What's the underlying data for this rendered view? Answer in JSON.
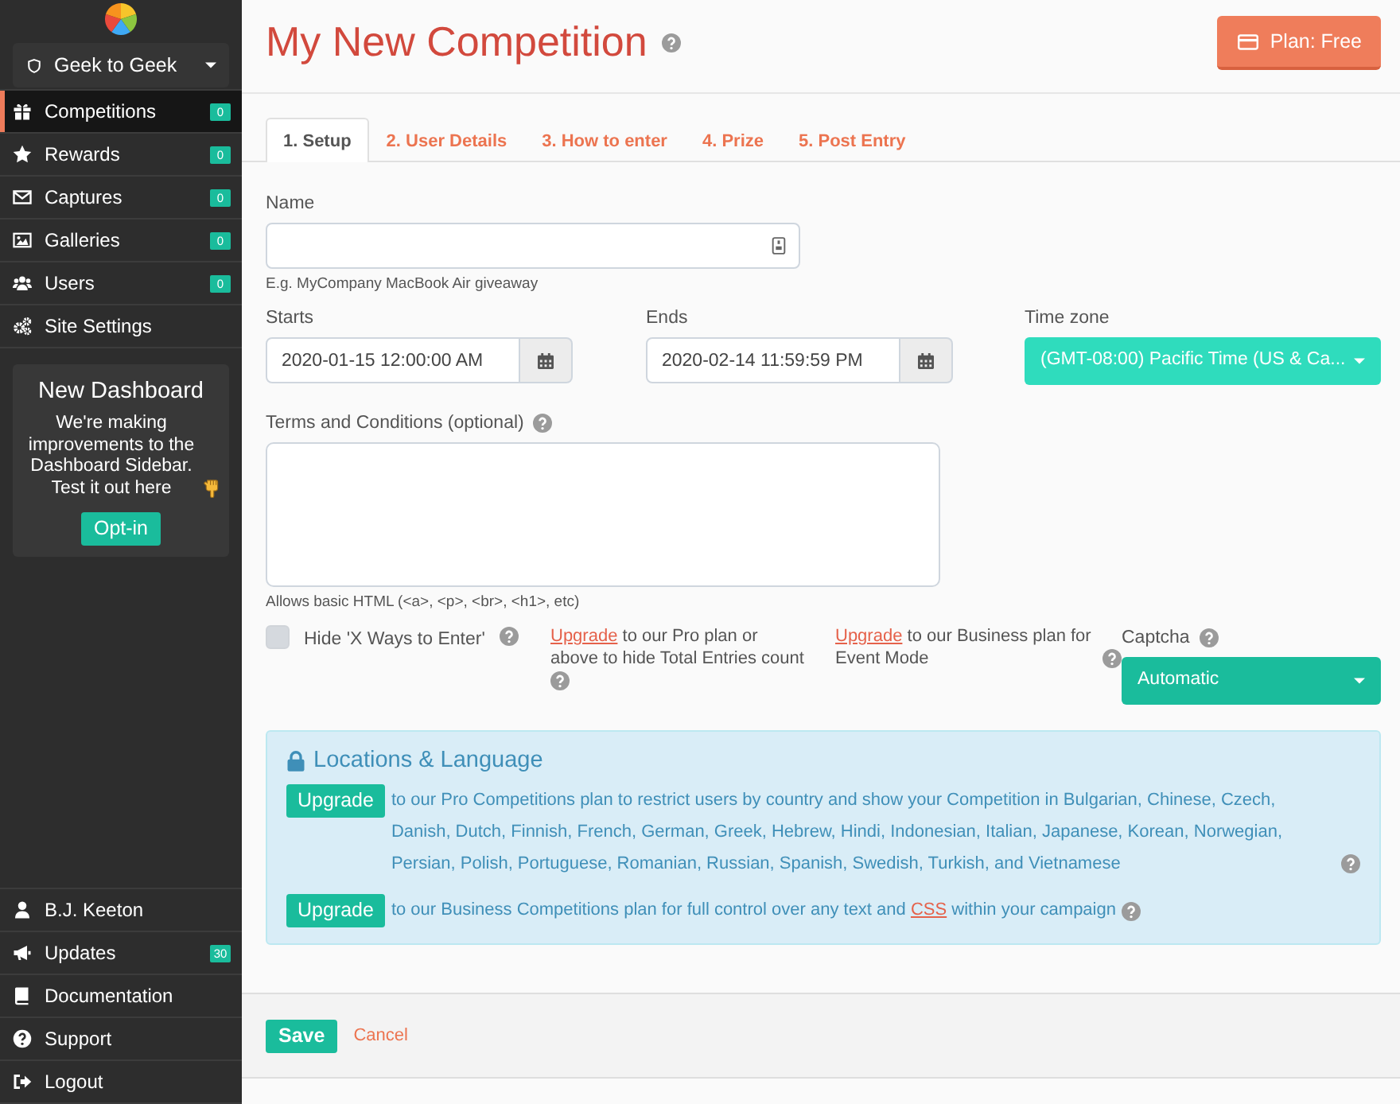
{
  "sidebar": {
    "account": "Geek to Geek",
    "nav_items": [
      {
        "label": "Competitions",
        "badge": "0",
        "selected": true
      },
      {
        "label": "Rewards",
        "badge": "0",
        "selected": false
      },
      {
        "label": "Captures",
        "badge": "0",
        "selected": false
      },
      {
        "label": "Galleries",
        "badge": "0",
        "selected": false
      },
      {
        "label": "Users",
        "badge": "0",
        "selected": false
      },
      {
        "label": "Site Settings",
        "selected": false
      }
    ],
    "promo": {
      "title": "New Dashboard",
      "text": "We're making improvements to the Dashboard Sidebar. Test it out here",
      "button": "Opt-in"
    },
    "footer_items": [
      {
        "label": "B.J. Keeton"
      },
      {
        "label": "Updates",
        "badge": "30"
      },
      {
        "label": "Documentation"
      },
      {
        "label": "Support"
      },
      {
        "label": "Logout"
      }
    ]
  },
  "header": {
    "title": "My New Competition",
    "plan_button": "Plan: Free"
  },
  "tabs": [
    {
      "label": "1. Setup",
      "selected": true
    },
    {
      "label": "2. User Details",
      "selected": false
    },
    {
      "label": "3. How to enter",
      "selected": false
    },
    {
      "label": "4. Prize",
      "selected": false
    },
    {
      "label": "5. Post Entry",
      "selected": false
    }
  ],
  "form": {
    "name": {
      "label": "Name",
      "help": "E.g. MyCompany MacBook Air giveaway"
    },
    "dates": [
      {
        "label": "Starts",
        "value": "2020-01-15 12:00:00 AM"
      },
      {
        "label": "Ends",
        "value": "2020-02-14 11:59:59 PM"
      }
    ],
    "time_zone": {
      "label": "Time zone",
      "value": "(GMT-08:00) Pacific Time (US & Ca..."
    },
    "terms": {
      "label": "Terms and Conditions (optional)",
      "help": "Allows basic HTML (<a>, <p>, <br>, <h1>, etc)"
    },
    "hide_ways": {
      "label": "Hide 'X Ways to Enter'",
      "checked": false,
      "disabled": true
    },
    "upsells": [
      {
        "link": "Upgrade",
        "text": "to our Pro plan or above to hide Total Entries count"
      },
      {
        "link": "Upgrade",
        "text": "to our Business plan for Event Mode"
      }
    ],
    "captcha": {
      "label": "Captcha",
      "value": "Automatic"
    }
  },
  "locations_panel": {
    "title": "Locations & Language",
    "rows": [
      {
        "button": "Upgrade",
        "text": "to our Pro Competitions plan to restrict users by country and show your Competition in Bulgarian, Chinese, Czech, Danish, Dutch, Finnish, French, German, Greek, Hebrew, Hindi, Indonesian, Italian, Japanese, Korean, Norwegian, Persian, Polish, Portuguese, Romanian, Russian, Spanish, Swedish, Turkish, and Vietnamese"
      },
      {
        "button": "Upgrade",
        "text": "to our Business Competitions plan for full control over any text and",
        "link": "CSS",
        "text_after": "within your campaign"
      }
    ]
  },
  "footer": {
    "save": "Save",
    "cancel": "Cancel"
  }
}
